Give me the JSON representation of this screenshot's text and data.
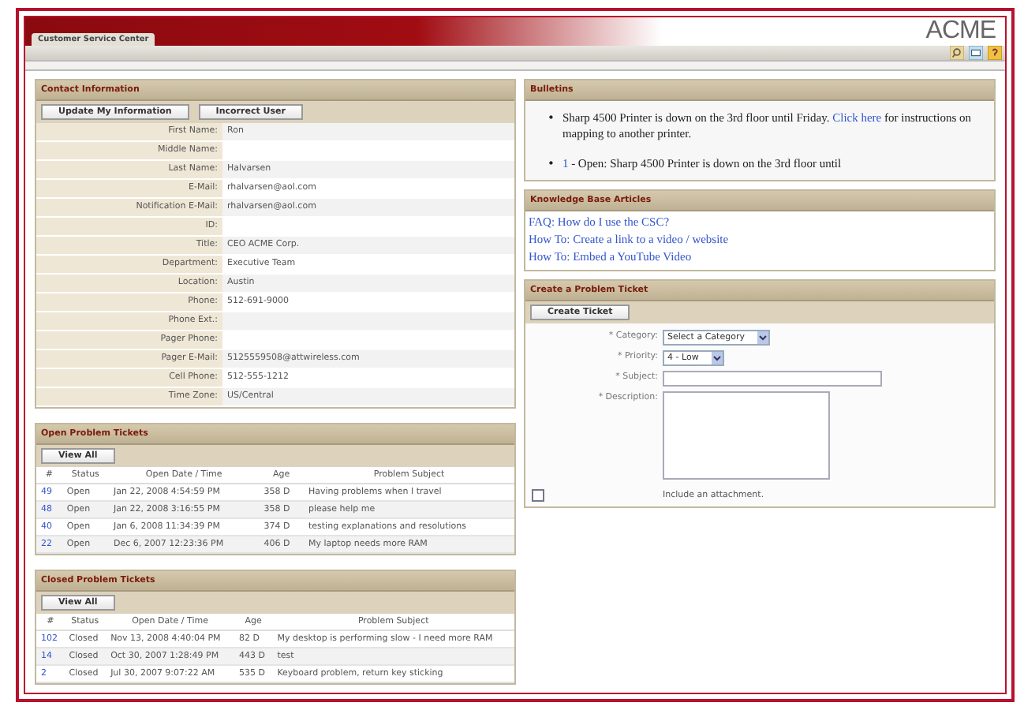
{
  "header": {
    "tab": "Customer Service Center",
    "logo": "ACME"
  },
  "contact": {
    "title": "Contact Information",
    "buttons": [
      "Update My Information",
      "Incorrect User"
    ],
    "fields": [
      {
        "label": "First Name:",
        "value": "Ron"
      },
      {
        "label": "Middle Name:"
      },
      {
        "label": "Last Name:",
        "value": "Halvarsen"
      },
      {
        "label": "E-Mail:",
        "value": "rhalvarsen@aol.com"
      },
      {
        "label": "Notification E-Mail:",
        "value": "rhalvarsen@aol.com"
      },
      {
        "label": "ID:"
      },
      {
        "label": "Title:",
        "value": "CEO ACME Corp."
      },
      {
        "label": "Department:",
        "value": "Executive Team"
      },
      {
        "label": "Location:",
        "value": "Austin"
      },
      {
        "label": "Phone:",
        "value": "512-691-9000"
      },
      {
        "label": "Phone Ext.:"
      },
      {
        "label": "Pager Phone:"
      },
      {
        "label": "Pager E-Mail:",
        "value": "5125559508@attwireless.com"
      },
      {
        "label": "Cell Phone:",
        "value": "512-555-1212"
      },
      {
        "label": "Time Zone:",
        "value": "US/Central"
      }
    ]
  },
  "open_tickets": {
    "title": "Open Problem Tickets",
    "button": "View All",
    "columns": [
      "#",
      "Status",
      "Open Date / Time",
      "Age",
      "Problem Subject"
    ],
    "rows": [
      [
        "49",
        "Open",
        "Jan 22, 2008 4:54:59 PM",
        "358 D",
        "Having problems when I travel"
      ],
      [
        "48",
        "Open",
        "Jan 22, 2008 3:16:55 PM",
        "358 D",
        "please help me"
      ],
      [
        "40",
        "Open",
        "Jan 6, 2008 11:34:39 PM",
        "374 D",
        "testing explanations and resolutions"
      ],
      [
        "22",
        "Open",
        "Dec 6, 2007 12:23:36 PM",
        "406 D",
        "My laptop needs more RAM"
      ]
    ]
  },
  "closed_tickets": {
    "title": "Closed Problem Tickets",
    "button": "View All",
    "columns": [
      "#",
      "Status",
      "Open Date / Time",
      "Age",
      "Problem Subject"
    ],
    "rows": [
      [
        "102",
        "Closed",
        "Nov 13, 2008 4:40:04 PM",
        "82 D",
        "My desktop is performing slow - I need more RAM"
      ],
      [
        "14",
        "Closed",
        "Oct 30, 2007 1:28:49 PM",
        "443 D",
        "test"
      ],
      [
        "2",
        "Closed",
        "Jul 30, 2007 9:07:22 AM",
        "535 D",
        "Keyboard problem, return key sticking"
      ]
    ]
  },
  "bulletins": {
    "title": "Bulletins",
    "items": [
      {
        "marker": "•",
        "before": "Sharp 4500 Printer is down on the 3rd floor until Friday. ",
        "link": "Click here",
        "after": " for instructions on mapping to another printer."
      },
      {
        "marker": "•",
        "link": "1",
        "after": " - Open: Sharp 4500 Printer is down on the 3rd floor until"
      }
    ]
  },
  "kb": {
    "title": "Knowledge Base Articles",
    "links": [
      "FAQ: How do I use the CSC?",
      "How To: Create a link to a video / website",
      "How To: Embed a YouTube Video"
    ]
  },
  "create_ticket": {
    "title": "Create a Problem Ticket",
    "button": "Create Ticket",
    "fields": [
      {
        "kind": "select",
        "label": "* Category:",
        "value": "Select a Category"
      },
      {
        "kind": "select",
        "label": "* Priority:",
        "value": "4 - Low"
      },
      {
        "kind": "text",
        "label": "* Subject:"
      },
      {
        "kind": "textarea",
        "label": "* Description:"
      }
    ],
    "attachment": {
      "label": "Include an attachment.",
      "checked": false
    }
  }
}
